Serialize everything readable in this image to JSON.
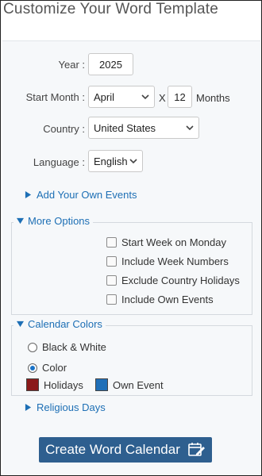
{
  "header": {
    "title": "Customize Your Word Template"
  },
  "form": {
    "year": {
      "label": "Year :",
      "value": "2025"
    },
    "start_month": {
      "label": "Start Month :",
      "value": "April",
      "x_label": "X",
      "months_count": "12",
      "months_label": "Months"
    },
    "country": {
      "label": "Country :",
      "value": "United States"
    },
    "language": {
      "label": "Language :",
      "value": "English"
    }
  },
  "own_events_link": "Add Your Own Events",
  "more_options": {
    "legend": "More Options",
    "checkboxes": [
      {
        "label": "Start Week on Monday",
        "checked": false
      },
      {
        "label": "Include Week Numbers",
        "checked": false
      },
      {
        "label": "Exclude Country Holidays",
        "checked": false
      },
      {
        "label": "Include Own Events",
        "checked": false
      }
    ]
  },
  "calendar_colors": {
    "legend": "Calendar Colors",
    "radios": [
      {
        "label": "Black & White",
        "selected": false
      },
      {
        "label": "Color",
        "selected": true
      }
    ],
    "holidays_label": "Holidays",
    "holidays_color": "#8b1a1a",
    "own_event_label": "Own Event",
    "own_event_color": "#1f6fb8"
  },
  "religious_days_link": "Religious Days",
  "create_button": {
    "label": "Create Word Calendar"
  },
  "colors": {
    "accent": "#1d6fb5",
    "button": "#2e5f8f"
  },
  "icons": {
    "expand": "triangle-right-icon",
    "collapse": "triangle-down-icon",
    "edit": "edit-calendar-icon"
  }
}
